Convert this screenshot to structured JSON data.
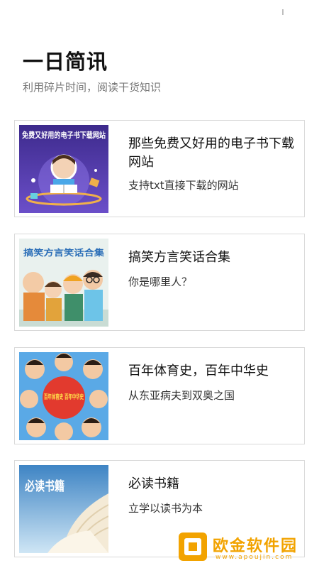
{
  "header": {
    "title": "一日简讯",
    "subtitle": "利用碎片时间，阅读干货知识"
  },
  "articles": [
    {
      "title": "那些免费又好用的电子书下载网站",
      "description": "支持txt直接下载的网站",
      "thumbnail_caption": "免费又好用的电子书下载网站"
    },
    {
      "title": "搞笑方言笑话合集",
      "description": "你是哪里人？",
      "thumbnail_caption": "搞笑方言笑话合集"
    },
    {
      "title": "百年体育史，百年中华史",
      "description": "从东亚病夫到双奥之国",
      "thumbnail_caption": "百年体育史 百年中华史"
    },
    {
      "title": "必读书籍",
      "description": "立学以读书为本",
      "thumbnail_caption": "必读书籍"
    }
  ],
  "watermark": {
    "name": "欧金软件园",
    "url": "www.apoujin.com"
  },
  "colors": {
    "accent": "#f2a300",
    "card_border": "#d9d9d9",
    "subtitle": "#777777"
  }
}
